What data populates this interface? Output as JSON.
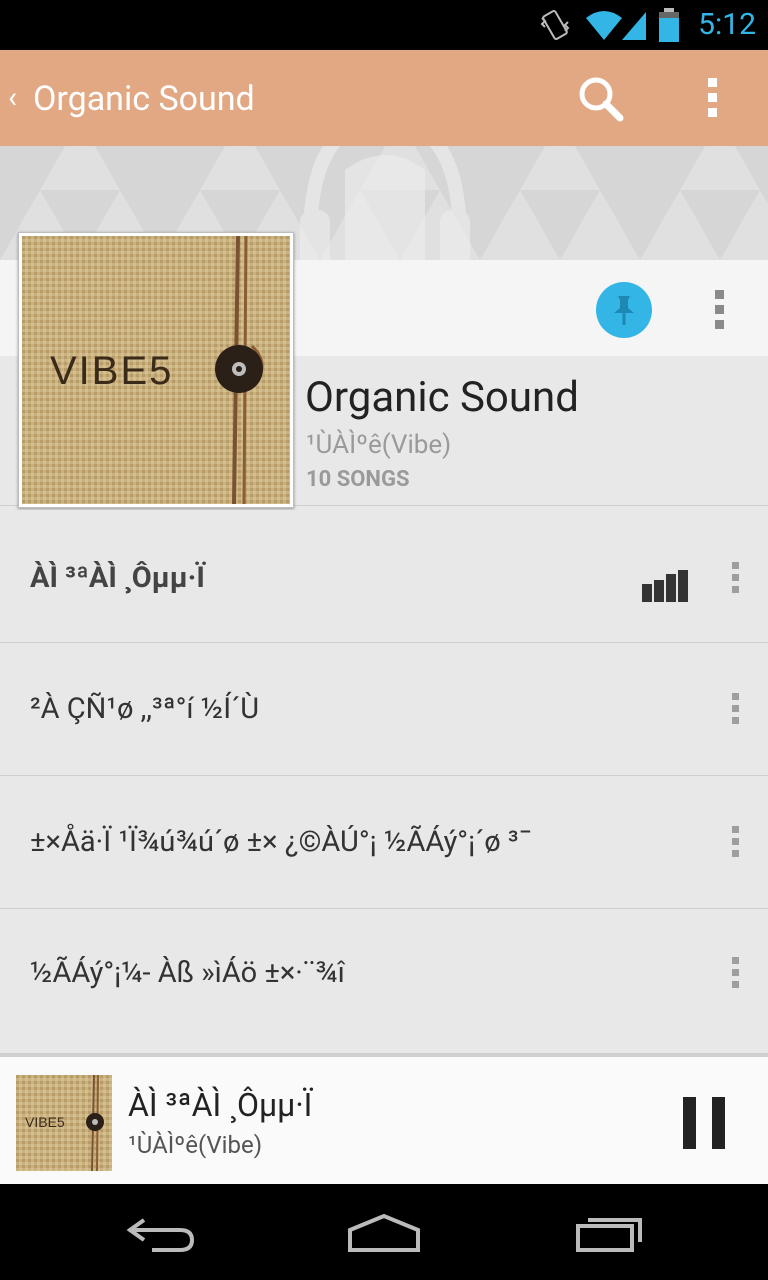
{
  "status_bar": {
    "time": "5:12",
    "icons": [
      "vibrate-icon",
      "wifi-icon",
      "signal-icon",
      "battery-icon"
    ],
    "accent_color": "#33b5e5"
  },
  "action_bar": {
    "title": "Organic Sound",
    "back_glyph": "‹",
    "background_color": "#e2a884",
    "icons": [
      "search-icon",
      "overflow-menu-icon"
    ]
  },
  "album": {
    "title": "Organic Sound",
    "artist": "¹ÙÀÌºê(Vibe)",
    "song_count": "10 SONGS",
    "cover_text": "VIBE5",
    "pin_color": "#33b5e5"
  },
  "tracks": [
    {
      "name": "ÀÌ ³ªÀÌ ¸Ôµµ·Ï",
      "playing": true
    },
    {
      "name": "²À ÇÑ¹ø ,,³ª°í ½Í´Ù",
      "playing": false
    },
    {
      "name": "±×Åä·Ï ¹Ï¾ú¾ú´ø ±× ¿©ÀÚ°¡ ½ÃÁý°¡´ø ³¯",
      "playing": false
    },
    {
      "name": "½ÃÁý°¡¼- Àß »ìÁö ±×·¨¾î",
      "playing": false
    }
  ],
  "now_playing": {
    "title": "ÀÌ ³ªÀÌ ¸Ôµµ·Ï",
    "artist": "¹ÙÀÌºê(Vibe)",
    "state": "playing"
  },
  "nav_bar": {
    "buttons": [
      "back-nav-icon",
      "home-nav-icon",
      "recents-nav-icon"
    ]
  }
}
